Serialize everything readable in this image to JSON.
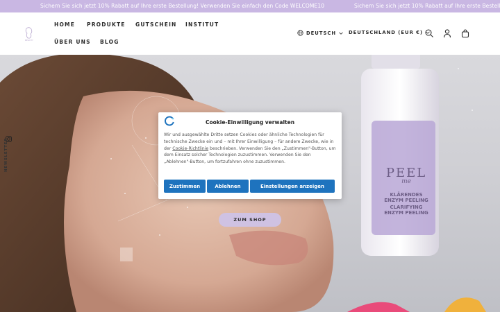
{
  "announcement": {
    "text": "Sichern Sie sich jetzt 10% Rabatt auf Ihre erste Bestellung! Verwenden Sie einfach den Code WELCOME10",
    "text_repeat": "Sichern Sie sich jetzt 10% Rabatt auf Ihre erste Bestellung!"
  },
  "header": {
    "nav": {
      "home": "HOME",
      "produkte": "PRODUKTE",
      "gutschein": "GUTSCHEIN",
      "institut": "INSTITUT",
      "ueber_uns": "ÜBER UNS",
      "blog": "BLOG"
    },
    "language": "DEUTSCH",
    "country": "DEUTSCHLAND (EUR €)"
  },
  "hero": {
    "newsletter_label": "NEWSLETTER",
    "shop_button": "ZUM SHOP",
    "product_label": {
      "brand": "PEEL",
      "brand_sub": "me",
      "line1": "KLÄRENDES",
      "line2": "ENZYM PEELING",
      "line3": "CLARIFYING",
      "line4": "ENZYM PEELING"
    }
  },
  "cookie": {
    "title": "Cookie-Einwilligung verwalten",
    "text_before_link": "Wir und ausgewählte Dritte setzen Cookies oder ähnliche Technologien für technische Zwecke ein und – mit Ihrer Einwilligung – für andere Zwecke, wie in der ",
    "link": "Cookie-Richtlinie",
    "text_after_link": " beschrieben. Verwenden Sie den „Zustimmen\"-Button, um dem Einsatz solcher Technologien zuzustimmen. Verwenden Sie den „Ablehnen\"-Button, um fortzufahren ohne zuzustimmen.",
    "accept": "Zustimmen",
    "reject": "Ablehnen",
    "settings": "Einstellungen anzeigen"
  },
  "colors": {
    "announcement_bg": "#c9b7e3",
    "button_blue": "#1e73be",
    "shop_button_bg": "#cfc2e3"
  },
  "icons": [
    "globe-icon",
    "chevron-down-icon",
    "search-icon",
    "account-icon",
    "bag-icon",
    "instagram-icon",
    "cookie-logo-icon"
  ]
}
